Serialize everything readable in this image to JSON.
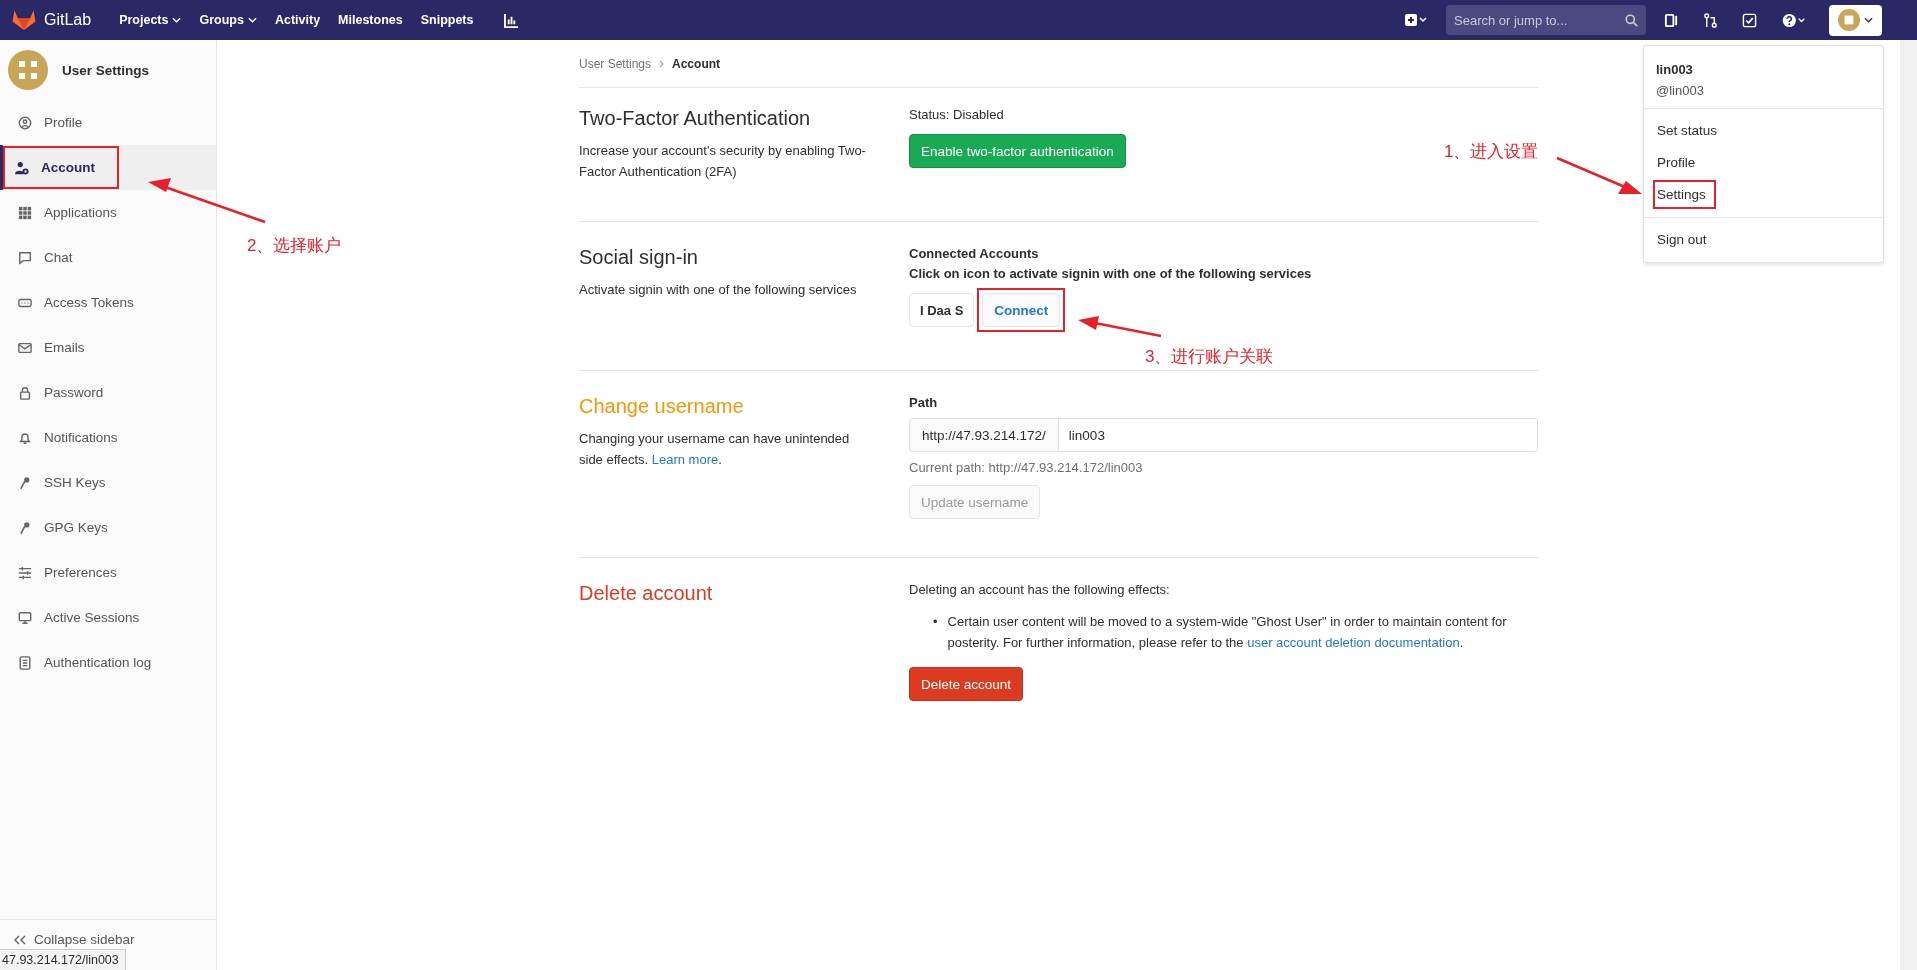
{
  "top_bar": {
    "brand": "GitLab",
    "nav": [
      {
        "label": "Projects",
        "dropdown": true
      },
      {
        "label": "Groups",
        "dropdown": true
      },
      {
        "label": "Activity",
        "dropdown": false
      },
      {
        "label": "Milestones",
        "dropdown": false
      },
      {
        "label": "Snippets",
        "dropdown": false
      }
    ],
    "search": {
      "placeholder": "Search or jump to..."
    }
  },
  "sidebar": {
    "title": "User Settings",
    "items": [
      {
        "label": "Profile",
        "selected": false,
        "highlighted": false
      },
      {
        "label": "Account",
        "selected": true,
        "highlighted": true
      },
      {
        "label": "Applications",
        "selected": false,
        "highlighted": false
      },
      {
        "label": "Chat",
        "selected": false,
        "highlighted": false
      },
      {
        "label": "Access Tokens",
        "selected": false,
        "highlighted": false
      },
      {
        "label": "Emails",
        "selected": false,
        "highlighted": false
      },
      {
        "label": "Password",
        "selected": false,
        "highlighted": false
      },
      {
        "label": "Notifications",
        "selected": false,
        "highlighted": false
      },
      {
        "label": "SSH Keys",
        "selected": false,
        "highlighted": false
      },
      {
        "label": "GPG Keys",
        "selected": false,
        "highlighted": false
      },
      {
        "label": "Preferences",
        "selected": false,
        "highlighted": false
      },
      {
        "label": "Active Sessions",
        "selected": false,
        "highlighted": false
      },
      {
        "label": "Authentication log",
        "selected": false,
        "highlighted": false
      }
    ],
    "collapse": "Collapse sidebar"
  },
  "breadcrumb": [
    "User Settings",
    "Account"
  ],
  "sections": [
    {
      "kind": "two_factor",
      "title": "Two-Factor Authentication",
      "description": "Increase your account's security by enabling Two-Factor Authentication (2FA)",
      "status": "Status: Disabled",
      "button": "Enable two-factor authentication"
    },
    {
      "kind": "social",
      "title": "Social sign-in",
      "description": "Activate signin with one of the following services",
      "heading": "Connected Accounts",
      "hint": "Click on icon to activate signin with one of the following services",
      "provider": "I Daa S",
      "button": "Connect",
      "highlighted": true
    },
    {
      "kind": "username",
      "title": "Change username",
      "description": "Changing your username can have unintended side effects.",
      "link": "Learn more",
      "link_end": ".",
      "path_label": "Path",
      "prefix": "http://47.93.214.172/",
      "value": "lin003",
      "current_path": "Current path: http://47.93.214.172/lin003",
      "button": "Update username"
    },
    {
      "kind": "delete",
      "title": "Delete account",
      "intro": "Deleting an account has the following effects:",
      "marker": "•",
      "bullet": "Certain user content will be moved to a system-wide \"Ghost User\" in order to maintain content for posterity. For further information, please refer to the",
      "link": "user account deletion documentation",
      "link_end": ".",
      "button": "Delete account"
    }
  ],
  "user_menu": {
    "name": "lin003",
    "handle": "@lin003",
    "items": [
      {
        "label": "Set status",
        "divider_before": false,
        "highlighted": false
      },
      {
        "label": "Profile",
        "divider_before": false,
        "highlighted": false
      },
      {
        "label": "Settings",
        "divider_before": false,
        "highlighted": true
      },
      {
        "label": "Sign out",
        "divider_before": true,
        "highlighted": false
      }
    ]
  },
  "annotations": [
    "1、进入设置",
    "2、选择账户",
    "3、进行账户关联"
  ],
  "status_bar": {
    "url": "47.93.214.172/lin003"
  }
}
